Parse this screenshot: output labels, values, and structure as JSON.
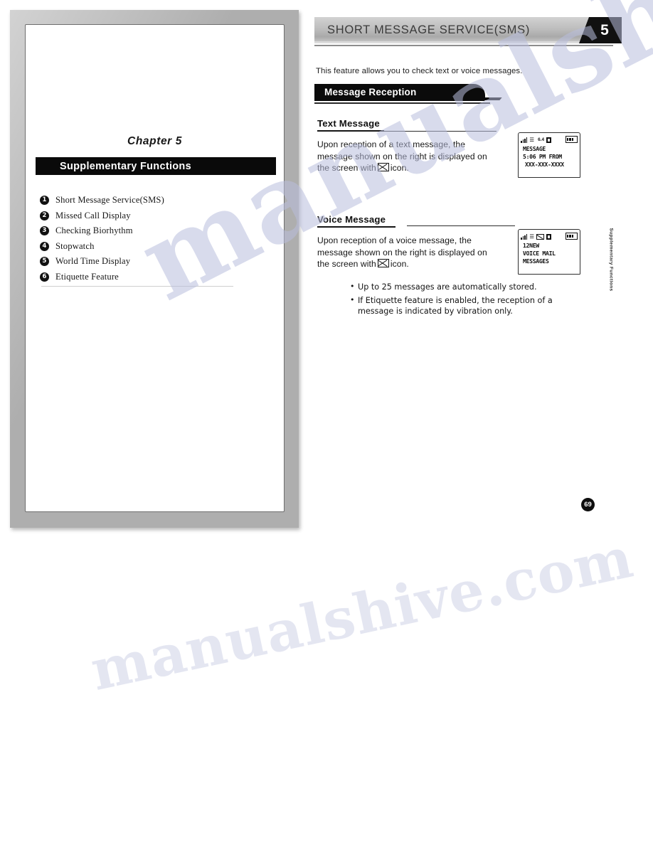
{
  "left_page": {
    "chapter_label": "Chapter 5",
    "chapter_title": "Supplementary Functions",
    "toc_items": [
      {
        "marker": "1",
        "label": "Short Message Service(SMS)"
      },
      {
        "marker": "2",
        "label": "Missed Call Display"
      },
      {
        "marker": "3",
        "label": "Checking Biorhythm"
      },
      {
        "marker": "4",
        "label": "Stopwatch"
      },
      {
        "marker": "5",
        "label": "World Time Display"
      },
      {
        "marker": "6",
        "label": "Etiquette Feature"
      }
    ]
  },
  "right_page": {
    "header_title": "SHORT MESSAGE SERVICE(SMS)",
    "chapter_number": "5",
    "intro": "This feature allows you to check text or voice messages.",
    "section_banner": "Message Reception",
    "text_message": {
      "heading": "Text Message",
      "body_line1": "Upon reception of a text message, the",
      "body_line2": "message shown on the right is displayed on",
      "body_line3_pre": "the screen with",
      "body_line3_post": "icon.",
      "lcd": {
        "status_signal": "signal-bars-icon",
        "status_roam": "roaming-icon",
        "status_number": "6.4",
        "status_block": "block-icon",
        "status_battery": "battery-icon",
        "line1": "MESSAGE",
        "line2": "5:06 PM FROM",
        "line3": "XXX-XXX-XXXX"
      }
    },
    "voice_message": {
      "heading": "Voice Message",
      "body_line1": "Upon reception of a voice message, the",
      "body_line2": "message shown on the right is displayed on",
      "body_line3_pre": "the screen with",
      "body_line3_post": "icon.",
      "lcd": {
        "status_signal": "signal-bars-icon",
        "status_roam": "roaming-icon",
        "status_envelope": "envelope-icon",
        "status_block": "block-icon",
        "status_battery": "battery-icon",
        "line1": "12NEW",
        "line2": "VOICE MAIL",
        "line3": "MESSAGES"
      }
    },
    "notes": [
      "Up to 25 messages are automatically stored.",
      "If Etiquette feature is enabled, the reception of a message is indicated by vibration only."
    ],
    "side_tab": "Supplementary Functions",
    "page_number": "69"
  },
  "watermark": {
    "line1": "manualshive.com",
    "line2": "manualshive.com"
  }
}
